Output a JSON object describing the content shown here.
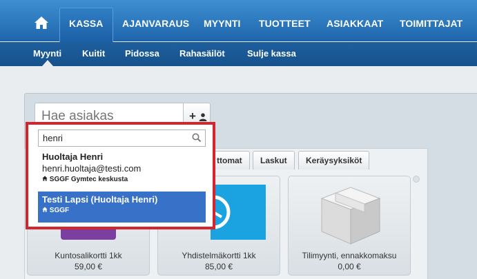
{
  "topnav": {
    "items": [
      "KASSA",
      "AJANVARAUS",
      "MYYNTI",
      "TUOTTEET",
      "ASIAKKAAT",
      "TOIMITTAJAT"
    ],
    "active": "KASSA"
  },
  "subnav": {
    "items": [
      "Myynti",
      "Kuitit",
      "Pidossa",
      "Rahasäilöt",
      "Sulje kassa"
    ],
    "active": "Myynti"
  },
  "customer": {
    "placeholder": "Hae asiakas"
  },
  "dropdown": {
    "search_value": "henri",
    "results": [
      {
        "name": "Huoltaja Henri",
        "email": "henri.huoltaja@testi.com",
        "org": "SGGF Gymtec keskusta"
      },
      {
        "name": "Testi Lapsi (Huoltaja Henri)",
        "org": "SGGF",
        "selected": true
      }
    ]
  },
  "tabs": [
    "ttomat",
    "Laskut",
    "Keräysyksiköt"
  ],
  "tiles": [
    {
      "name": "Kuntosalikortti 1kk",
      "price": "59,00 €"
    },
    {
      "name": "Yhdistelmäkortti 1kk",
      "price": "85,00 €"
    },
    {
      "name": "Tilimyynti, ennakkomaksu",
      "price": "0,00 €"
    }
  ],
  "colors": {
    "nav_blue": "#2a78c0",
    "selection_blue": "#3771c8",
    "highlight_red": "#d4242c",
    "tile_purple": "#7b3fa0",
    "tile_cyan": "#1aa3e0"
  }
}
